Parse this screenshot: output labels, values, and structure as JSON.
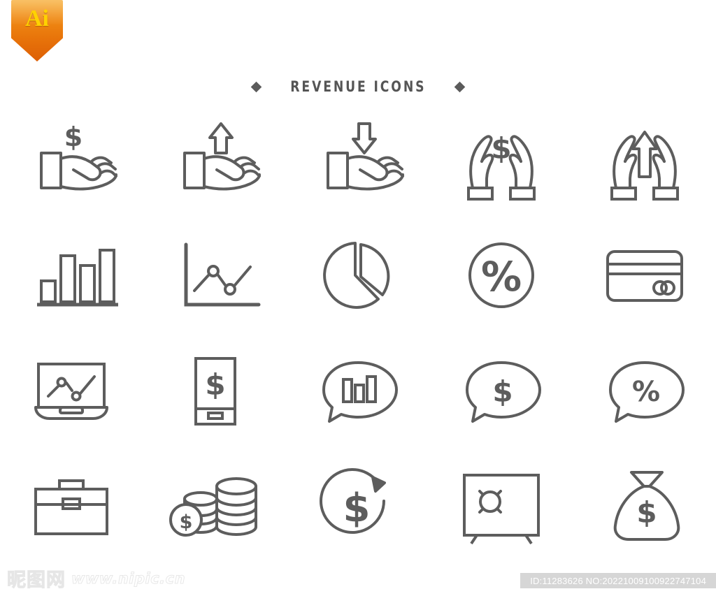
{
  "badge": {
    "label": "Ai",
    "name": "adobe-illustrator-badge",
    "colors": {
      "top": "#f6a623",
      "bottom": "#dd5f05",
      "text": "#ffd200"
    }
  },
  "header": {
    "title": "REVENUE ICONS",
    "ornament": "diamond",
    "color": "#555555"
  },
  "icons": {
    "stroke_color": "#5d5d5d",
    "rows": [
      [
        {
          "name": "hand-with-dollar-icon",
          "label": "Hand holding dollar"
        },
        {
          "name": "hand-with-up-arrow-icon",
          "label": "Hand with up arrow"
        },
        {
          "name": "hand-with-down-arrow-icon",
          "label": "Hand with down arrow"
        },
        {
          "name": "two-hands-dollar-icon",
          "label": "Two hands protecting dollar"
        },
        {
          "name": "two-hands-up-arrow-icon",
          "label": "Two hands with up arrow"
        }
      ],
      [
        {
          "name": "bar-chart-icon",
          "label": "Bar chart"
        },
        {
          "name": "line-graph-icon",
          "label": "Line graph with axes"
        },
        {
          "name": "pie-chart-icon",
          "label": "Pie chart with slice"
        },
        {
          "name": "percent-circle-icon",
          "label": "Percent in circle"
        },
        {
          "name": "credit-card-icon",
          "label": "Credit card"
        }
      ],
      [
        {
          "name": "laptop-chart-icon",
          "label": "Laptop with line chart"
        },
        {
          "name": "smartphone-dollar-icon",
          "label": "Smartphone with dollar"
        },
        {
          "name": "speech-bubble-bar-chart-icon",
          "label": "Speech bubble with bar chart"
        },
        {
          "name": "speech-bubble-dollar-icon",
          "label": "Speech bubble with dollar"
        },
        {
          "name": "speech-bubble-percent-icon",
          "label": "Speech bubble with percent"
        }
      ],
      [
        {
          "name": "briefcase-icon",
          "label": "Briefcase"
        },
        {
          "name": "coin-stacks-icon",
          "label": "Stacks of coins"
        },
        {
          "name": "dollar-refresh-icon",
          "label": "Dollar with circular arrow"
        },
        {
          "name": "safe-vault-icon",
          "label": "Safe vault"
        },
        {
          "name": "money-bag-icon",
          "label": "Money bag with dollar"
        }
      ]
    ],
    "symbols": {
      "dollar": "$",
      "percent": "%"
    }
  },
  "footer": {
    "watermark_cn": "昵图网",
    "watermark_url": "www.nipic.cn",
    "id_text": "ID:11283626 NO:20221009100922747104"
  }
}
